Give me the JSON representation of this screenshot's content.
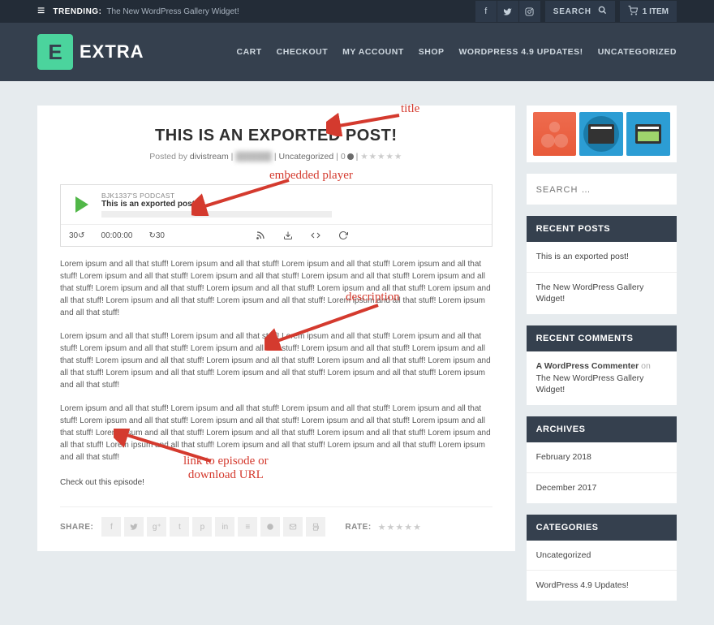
{
  "topbar": {
    "trending_label": "TRENDING:",
    "trending_link": "The New WordPress Gallery Widget!",
    "search_placeholder": "SEARCH",
    "cart_label": "1 ITEM"
  },
  "header": {
    "logo_text": "EXTRA",
    "nav": [
      "CART",
      "CHECKOUT",
      "MY ACCOUNT",
      "SHOP",
      "WORDPRESS 4.9 UPDATES!",
      "UNCATEGORIZED"
    ]
  },
  "post": {
    "title": "THIS IS AN EXPORTED POST!",
    "meta_posted_by": "Posted by",
    "meta_author": "divistream",
    "meta_blur": "██████",
    "meta_category": "Uncategorized",
    "meta_comments": "0",
    "meta_stars": "★★★★★",
    "player": {
      "podcast_label": "BJK1337'S PODCAST",
      "episode_title": "This is an exported post!",
      "back": "30",
      "time": "00:00:00",
      "fwd": "30"
    },
    "description_p1": "Lorem ipsum and all that stuff! Lorem ipsum and all that stuff! Lorem ipsum and all that stuff! Lorem ipsum and all that stuff! Lorem ipsum and all that stuff! Lorem ipsum and all that stuff! Lorem ipsum and all that stuff! Lorem ipsum and all that stuff! Lorem ipsum and all that stuff! Lorem ipsum and all that stuff! Lorem ipsum and all that stuff! Lorem ipsum and all that stuff! Lorem ipsum and all that stuff! Lorem ipsum and all that stuff! Lorem ipsum and all that stuff! Lorem ipsum and all that stuff!",
    "description_p2": "Lorem ipsum and all that stuff! Lorem ipsum and all that stuff! Lorem ipsum and all that stuff! Lorem ipsum and all that stuff! Lorem ipsum and all that stuff! Lorem ipsum and all that stuff! Lorem ipsum and all that stuff! Lorem ipsum and all that stuff! Lorem ipsum and all that stuff! Lorem ipsum and all that stuff! Lorem ipsum and all that stuff! Lorem ipsum and all that stuff! Lorem ipsum and all that stuff! Lorem ipsum and all that stuff! Lorem ipsum and all that stuff! Lorem ipsum and all that stuff!",
    "description_p3": "Lorem ipsum and all that stuff! Lorem ipsum and all that stuff! Lorem ipsum and all that stuff! Lorem ipsum and all that stuff! Lorem ipsum and all that stuff! Lorem ipsum and all that stuff! Lorem ipsum and all that stuff! Lorem ipsum and all that stuff! Lorem ipsum and all that stuff! Lorem ipsum and all that stuff! Lorem ipsum and all that stuff! Lorem ipsum and all that stuff! Lorem ipsum and all that stuff! Lorem ipsum and all that stuff! Lorem ipsum and all that stuff! Lorem ipsum and all that stuff!",
    "episode_link": "Check out this episode!",
    "share_label": "SHARE:",
    "rate_label": "RATE:",
    "rate_stars": "★★★★★"
  },
  "sidebar": {
    "search_placeholder": "SEARCH …",
    "recent_posts": {
      "head": "RECENT POSTS",
      "items": [
        "This is an exported post!",
        "The New WordPress Gallery Widget!"
      ]
    },
    "recent_comments": {
      "head": "RECENT COMMENTS",
      "commenter": "A WordPress Commenter",
      "on": " on ",
      "target": "The New WordPress Gallery Widget!"
    },
    "archives": {
      "head": "ARCHIVES",
      "items": [
        "February 2018",
        "December 2017"
      ]
    },
    "categories": {
      "head": "CATEGORIES",
      "items": [
        "Uncategorized",
        "WordPress 4.9 Updates!"
      ]
    }
  },
  "annotations": {
    "title": "title",
    "player": "embedded player",
    "desc": "description",
    "link": "link to episode or\ndownload URL"
  }
}
